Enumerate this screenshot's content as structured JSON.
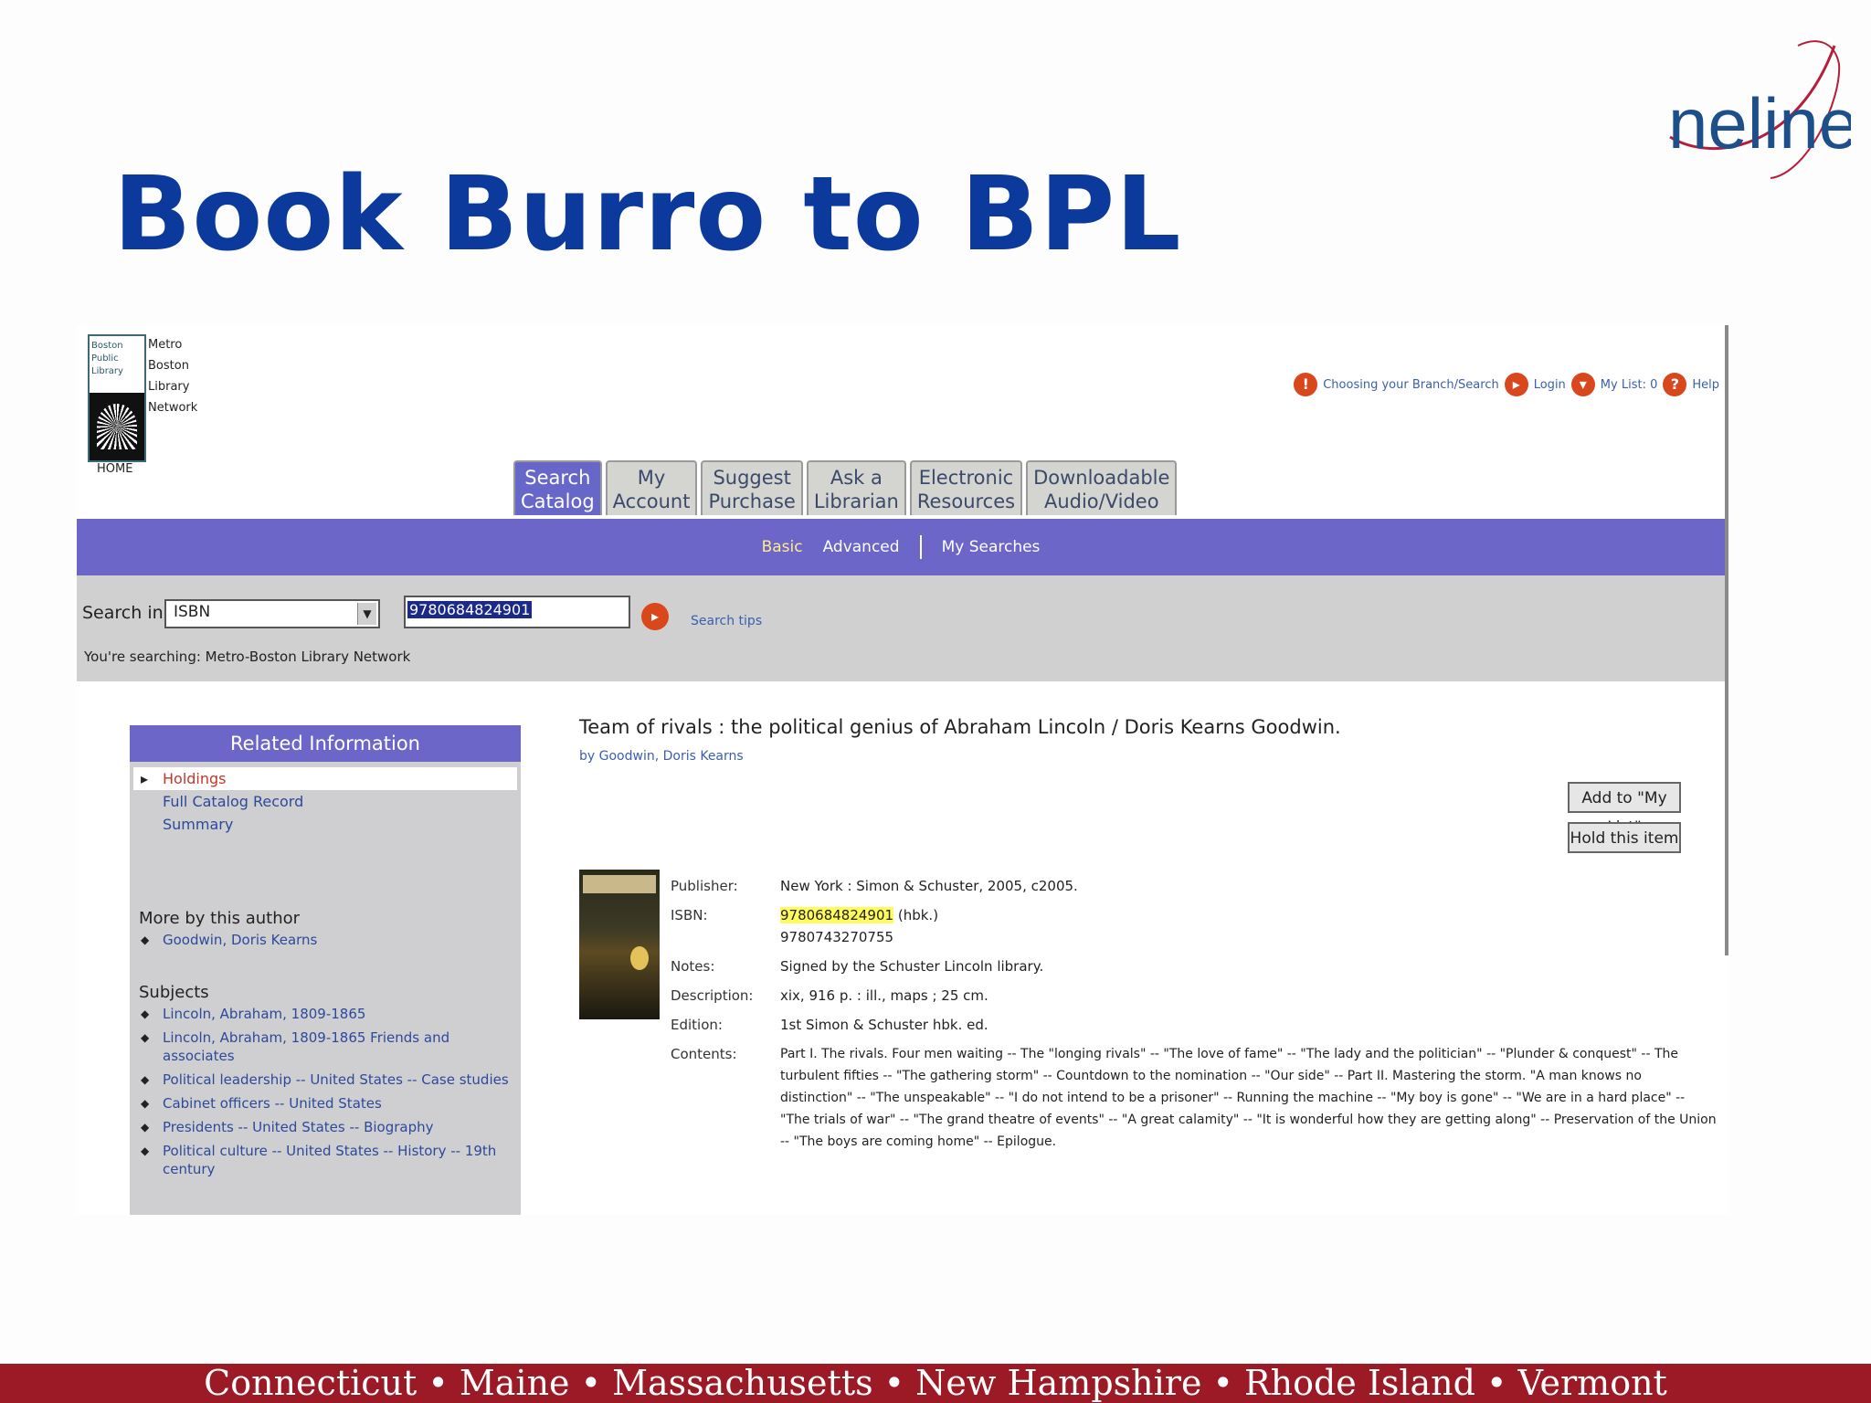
{
  "slide": {
    "title": "Book Burro to BPL",
    "logo_text": "nelinet",
    "footer": "Connecticut • Maine • Massachusetts • New Hampshire • Rhode Island • Vermont"
  },
  "catalog": {
    "library_logo": {
      "name_lines": [
        "Boston",
        "Public",
        "Library"
      ],
      "side_lines": [
        "Metro",
        "Boston",
        "Library",
        "Network"
      ],
      "home": "HOME"
    },
    "top_links": [
      {
        "icon": "info-icon",
        "label": "Choosing your Branch/Search"
      },
      {
        "icon": "login-icon",
        "label": "Login"
      },
      {
        "icon": "list-icon",
        "label": "My List: 0"
      },
      {
        "icon": "help-icon",
        "label": "Help"
      }
    ],
    "tabs": [
      {
        "line1": "Search",
        "line2": "Catalog"
      },
      {
        "line1": "My",
        "line2": "Account"
      },
      {
        "line1": "Suggest",
        "line2": "Purchase"
      },
      {
        "line1": "Ask a",
        "line2": "Librarian"
      },
      {
        "line1": "Electronic",
        "line2": "Resources"
      },
      {
        "line1": "Downloadable",
        "line2": "Audio/Video"
      }
    ],
    "subnav": {
      "basic": "Basic",
      "advanced": "Advanced",
      "my_searches": "My Searches"
    },
    "search": {
      "label": "Search in",
      "select_value": "ISBN",
      "input_value": "9780684824901",
      "tips": "Search tips",
      "scope": "You're searching: Metro-Boston Library Network"
    },
    "sidebar": {
      "header": "Related Information",
      "items": [
        "Holdings",
        "Full Catalog Record",
        "Summary"
      ],
      "more_by_author_header": "More by this author",
      "more_by_author": [
        "Goodwin, Doris Kearns"
      ],
      "subjects_header": "Subjects",
      "subjects": [
        "Lincoln, Abraham, 1809-1865",
        "Lincoln, Abraham, 1809-1865 Friends and associates",
        "Political leadership -- United States -- Case studies",
        "Cabinet officers -- United States",
        "Presidents -- United States -- Biography",
        "Political culture -- United States -- History -- 19th century"
      ]
    },
    "record": {
      "title": "Team of rivals : the political genius of Abraham Lincoln / Doris Kearns Goodwin.",
      "by": "by Goodwin, Doris Kearns",
      "add_button": "Add to \"My List\"",
      "hold_button": "Hold this item",
      "fields": [
        {
          "label": "Publisher:",
          "value": "New York : Simon & Schuster, 2005, c2005."
        },
        {
          "label": "ISBN:",
          "value_hl": "9780684824901",
          "value": "(hbk.)",
          "extra": "9780743270755"
        },
        {
          "label": "Notes:",
          "value": "Signed by the Schuster Lincoln library."
        },
        {
          "label": "Description:",
          "value": "xix, 916 p. : ill., maps ; 25 cm."
        },
        {
          "label": "Edition:",
          "value": "1st Simon & Schuster hbk. ed."
        },
        {
          "label": "Contents:",
          "value": "Part I. The rivals. Four men waiting -- The \"longing rivals\" -- \"The love of fame\" -- \"The lady and the politician\" -- \"Plunder & conquest\" -- The turbulent fifties -- \"The gathering storm\" -- Countdown to the nomination -- \"Our side\" -- Part II. Mastering the storm. \"A man knows no distinction\" -- \"The unspeakable\" -- \"I do not intend to be a prisoner\" -- Running the machine -- \"My boy is gone\" -- \"We are in a hard place\" -- \"The trials of war\" -- \"The grand theatre of events\" -- \"A great calamity\" -- \"It is wonderful how they are getting along\" -- Preservation of the Union -- \"The boys are coming home\" -- Epilogue."
        }
      ]
    }
  }
}
